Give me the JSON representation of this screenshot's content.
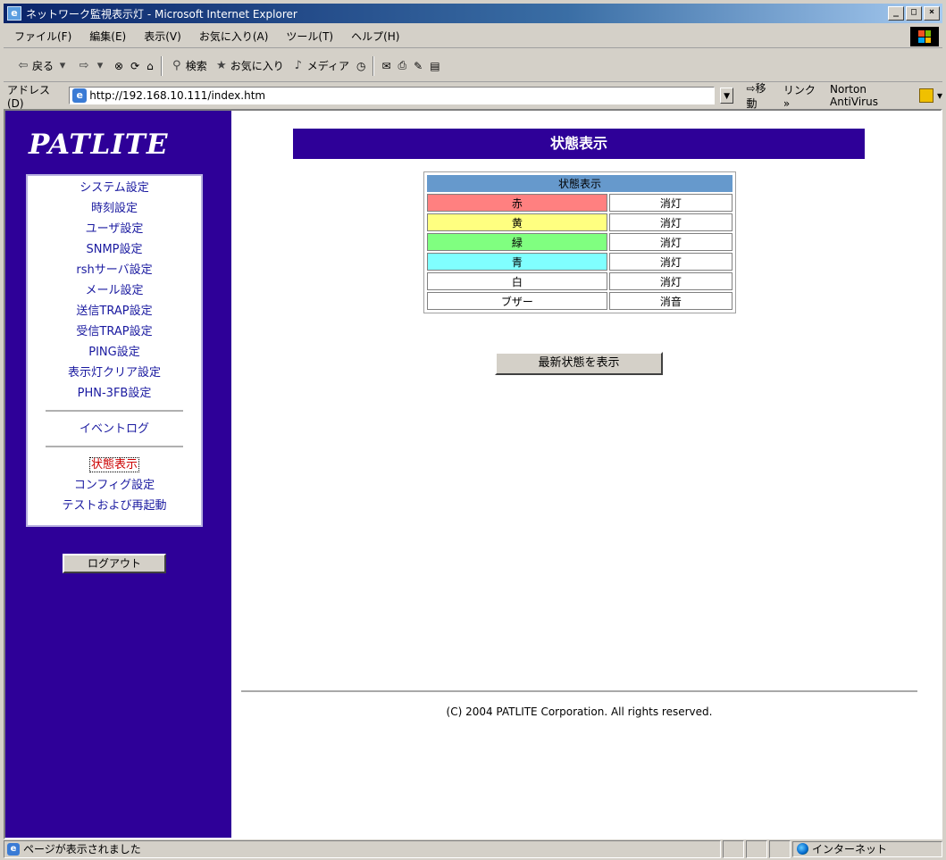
{
  "window": {
    "title": "ネットワーク監視表示灯 - Microsoft Internet Explorer",
    "buttons": [
      "_",
      "□",
      "×"
    ]
  },
  "menu": [
    "ファイル(F)",
    "編集(E)",
    "表示(V)",
    "お気に入り(A)",
    "ツール(T)",
    "ヘルプ(H)"
  ],
  "toolbar": {
    "back": "戻る",
    "search": "検索",
    "favorites": "お気に入り",
    "media": "メディア"
  },
  "address": {
    "label": "アドレス(D)",
    "url": "http://192.168.10.111/index.htm",
    "go": "移動",
    "links": "リンク »",
    "norton": "Norton AntiVirus"
  },
  "sidebar": {
    "logo": "PATLITE",
    "items": [
      "システム設定",
      "時刻設定",
      "ユーザ設定",
      "SNMP設定",
      "rshサーバ設定",
      "メール設定",
      "送信TRAP設定",
      "受信TRAP設定",
      "PING設定",
      "表示灯クリア設定",
      "PHN-3FB設定"
    ],
    "event_log": "イベントログ",
    "lower_items": [
      "状態表示",
      "コンフィグ設定",
      "テストおよび再起動"
    ],
    "logout": "ログアウト"
  },
  "main": {
    "banner": "状態表示",
    "table_header": "状態表示",
    "rows": [
      {
        "name": "赤",
        "state": "消灯",
        "color": "#ff8080"
      },
      {
        "name": "黄",
        "state": "消灯",
        "color": "#ffff80"
      },
      {
        "name": "緑",
        "state": "消灯",
        "color": "#80ff80"
      },
      {
        "name": "青",
        "state": "消灯",
        "color": "#80ffff"
      },
      {
        "name": "白",
        "state": "消灯",
        "color": "#ffffff"
      },
      {
        "name": "ブザー",
        "state": "消音",
        "color": "#ffffff"
      }
    ],
    "refresh_button": "最新状態を表示",
    "copyright": "(C) 2004 PATLITE Corporation. All rights reserved."
  },
  "statusbar": {
    "message": "ページが表示されました",
    "zone": "インターネット"
  },
  "colors": {
    "sidebar_bg": "#2e0098",
    "active_nav": "#cc0000",
    "table_header": "#6699cc"
  }
}
